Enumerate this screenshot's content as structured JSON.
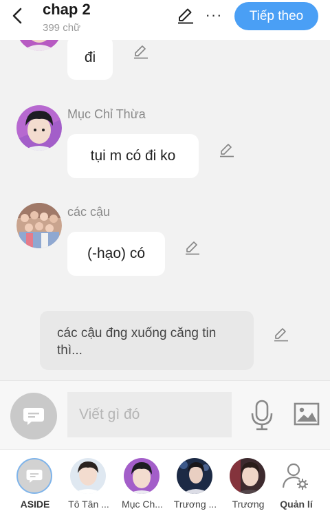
{
  "header": {
    "title": "chap 2",
    "word_count": "399 chữ",
    "next_label": "Tiếp theo",
    "more_label": "···",
    "accent": "#4a9ff5"
  },
  "messages": [
    {
      "speaker": "",
      "text": "đi",
      "avatar": "purple-portrait"
    },
    {
      "speaker": "Mục Chỉ Thừa",
      "text": "tụi m có đi ko",
      "avatar": "boy-portrait"
    },
    {
      "speaker": "các cậu",
      "text": "(-hạo) có",
      "avatar": "group-photo"
    }
  ],
  "narration": {
    "text": "các cậu đng xuống căng tin thì..."
  },
  "composer": {
    "placeholder": "Viết gì đó",
    "mic_icon": "microphone-icon",
    "image_icon": "image-icon"
  },
  "characters": [
    {
      "name": "ASIDE",
      "avatar": "chat-bubble-icon"
    },
    {
      "name": "Tô Tân ...",
      "avatar": "boy-portrait-white"
    },
    {
      "name": "Mục Ch...",
      "avatar": "boy-portrait-purple"
    },
    {
      "name": "Trương ...",
      "avatar": "singer-photo"
    },
    {
      "name": "Trương",
      "avatar": "boy-portrait-red"
    },
    {
      "name": "Quản lí",
      "avatar": "manage-user-icon"
    }
  ]
}
